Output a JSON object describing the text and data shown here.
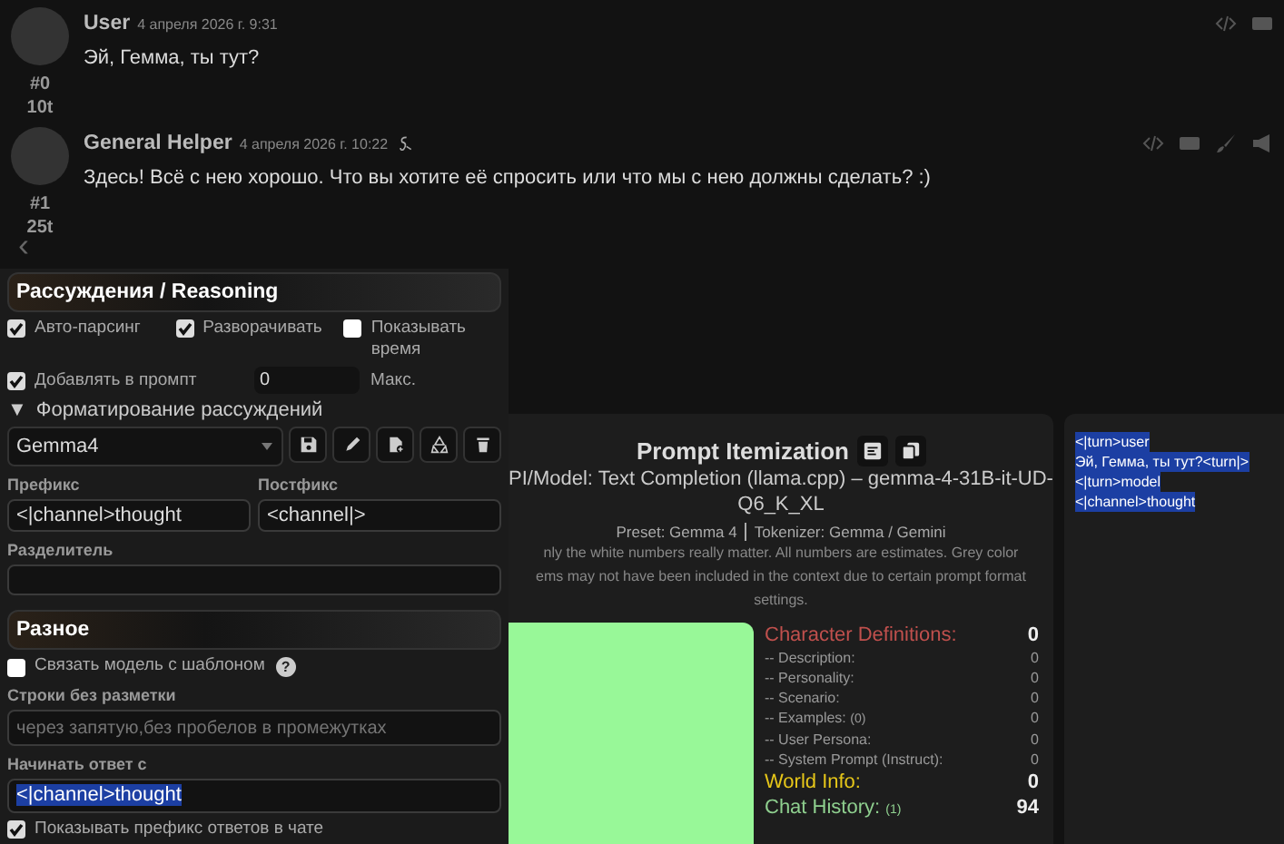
{
  "messages": [
    {
      "name": "User",
      "date": "4 апреля 2026 г. 9:31",
      "text": "Эй, Гемма, ты тут?",
      "index": "#0",
      "tokens": "10t",
      "reasoning": false
    },
    {
      "name": "General Helper",
      "date": "4 апреля 2026 г. 10:22",
      "text": "Здесь! Всё с нею хорошо. Что вы хотите её спросить или что мы с нею должны сделать? :)",
      "index": "#1",
      "tokens": "25t",
      "reasoning": true
    }
  ],
  "nav_arrow": "‹",
  "reasoning_panel": {
    "title": "Рассуждения / Reasoning",
    "options": [
      {
        "label": "Авто-парсинг",
        "checked": true
      },
      {
        "label": "Разворачивать",
        "checked": true
      },
      {
        "label": "Показывать время",
        "checked": false
      }
    ],
    "add_to_prompt": {
      "label": "Добавлять в промпт",
      "checked": true
    },
    "max_field": {
      "value": "0",
      "label": "Макс."
    },
    "formatting": {
      "arrow": "▼",
      "label": "Форматирование рассуждений",
      "expanded": true
    },
    "preset_select": {
      "value": "Gemma4"
    },
    "prefix": {
      "label": "Префикс",
      "value": "<|channel>thought"
    },
    "postfix": {
      "label": "Постфикс",
      "value": "<channel|>"
    },
    "separator": {
      "label": "Разделитель"
    }
  },
  "misc_panel": {
    "title": "Разное",
    "bind_model": {
      "label": "Связать модель с шаблоном",
      "checked": false,
      "help": "?"
    },
    "plain_strings": {
      "label": "Строки без разметки",
      "placeholder": "через запятую,без пробелов в промежутках"
    },
    "start_reply": {
      "label": "Начинать ответ с",
      "value": "<|channel>thought",
      "highlighted": true
    },
    "show_prefix": {
      "label": "Показывать префикс ответов в чате",
      "checked": true
    }
  },
  "itemization": {
    "title": "Prompt Itemization",
    "model_lines": [
      "PI/Model: Text Completion (llama.cpp) – gemma-4-31B-it-UD-",
      "Q6_K_XL"
    ],
    "preset": "Preset: Gemma 4",
    "tokenizer": "Tokenizer: Gemma / Gemini",
    "note_lines": [
      "nly the white numbers really matter. All numbers are estimates. Grey color",
      "ems may not have been included in the context due to certain prompt format",
      "settings."
    ],
    "rows": [
      {
        "kind": "header",
        "label": "Character Definitions:",
        "value": "0",
        "color": "#c0504d"
      },
      {
        "kind": "sub",
        "label": "-- Description:",
        "value": "0"
      },
      {
        "kind": "sub",
        "label": "-- Personality:",
        "value": "0"
      },
      {
        "kind": "sub",
        "label": "-- Scenario:",
        "value": "0"
      },
      {
        "kind": "sub",
        "label": "-- Examples:",
        "note": "(0)",
        "value": "0"
      },
      {
        "kind": "sub",
        "label": "-- User Persona:",
        "value": "0"
      },
      {
        "kind": "sub",
        "label": "-- System Prompt (Instruct):",
        "value": "0"
      },
      {
        "kind": "header",
        "label": "World Info:",
        "value": "0",
        "color": "#e6c619"
      },
      {
        "kind": "header",
        "label": "Chat History:",
        "note": "(1)",
        "value": "94",
        "color": "#8fd08f"
      }
    ]
  },
  "raw_prompt": {
    "highlighted": true,
    "lines": [
      "<|turn>user",
      "Эй, Гемма, ты тут?<turn|>",
      "<|turn>model",
      "<|channel>thought"
    ]
  }
}
